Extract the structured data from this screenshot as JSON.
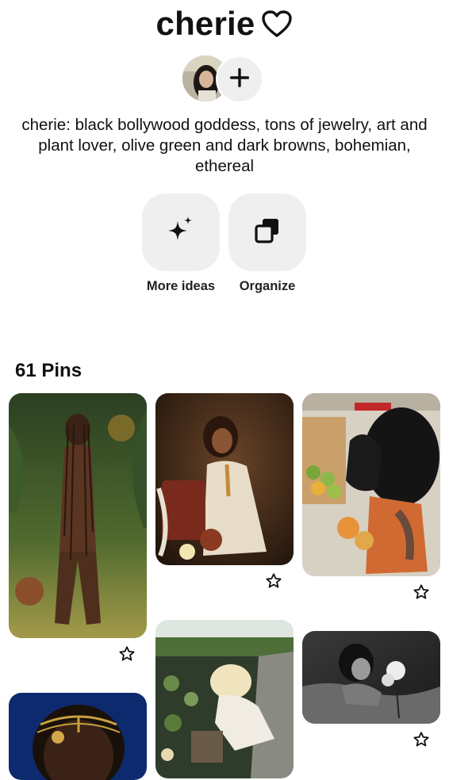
{
  "board": {
    "title": "cherie",
    "title_icon": "heart-outline-icon",
    "description": "cherie: black bollywood goddess, tons of jewelry, art and plant lover, olive green and dark browns, bohemian, ethereal"
  },
  "collaborators": {
    "avatar_icon": "user-avatar",
    "add_icon": "plus-icon"
  },
  "actions": [
    {
      "label": "More ideas",
      "icon": "sparkle-icon"
    },
    {
      "label": "Organize",
      "icon": "organize-icon"
    }
  ],
  "pins_header": {
    "count_label": "61 Pins"
  },
  "pins": [
    {
      "name": "pin-woman-coconuts-jungle",
      "save_icon": "star-outline-icon",
      "colors": [
        "#2f4a24",
        "#6b7a3a",
        "#8a5a3a"
      ]
    },
    {
      "name": "pin-woman-gold-jewelry-flowers",
      "save_icon": "star-outline-icon",
      "colors": [
        "#2a1a10",
        "#5a3a22",
        "#e8dccb"
      ]
    },
    {
      "name": "pin-woman-mangoes-market",
      "save_icon": "star-outline-icon",
      "colors": [
        "#d8d2c6",
        "#e09a3a",
        "#151515"
      ]
    },
    {
      "name": "pin-woman-headpiece-blue",
      "save_icon": "star-outline-icon",
      "colors": [
        "#0f2a6b",
        "#c8a040",
        "#3a2418"
      ]
    },
    {
      "name": "pin-woman-lily-pond",
      "save_icon": "star-outline-icon",
      "colors": [
        "#6f8a5a",
        "#e9e0c4",
        "#3a4a30"
      ]
    },
    {
      "name": "pin-woman-bw-water-flower",
      "save_icon": "star-outline-icon",
      "colors": [
        "#2a2a2a",
        "#9a9a9a",
        "#e8e8e8"
      ]
    }
  ],
  "accent": {
    "text": "#111111",
    "tile_bg": "#efefef"
  }
}
